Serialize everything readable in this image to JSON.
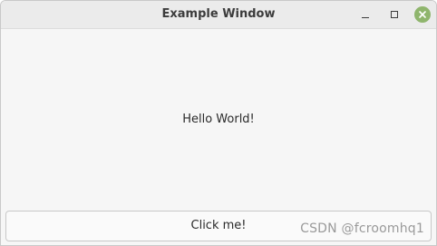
{
  "window": {
    "title": "Example Window"
  },
  "content": {
    "label_text": "Hello World!",
    "button_label": "Click me!"
  },
  "watermark": {
    "text": "CSDN @fcroomhq1"
  },
  "icons": {
    "minimize": "minimize-icon",
    "maximize": "maximize-icon",
    "close": "close-icon"
  },
  "colors": {
    "close_button": "#8fb56d",
    "titlebar": "#ebebeb",
    "window_bg": "#f6f6f6"
  }
}
